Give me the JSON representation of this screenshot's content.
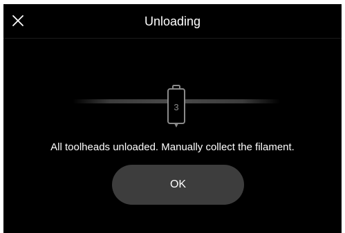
{
  "header": {
    "title": "Unloading",
    "close_icon": "close-icon"
  },
  "toolhead": {
    "number": "3",
    "icon": "toolhead-icon"
  },
  "message": "All toolheads unloaded. Manually collect the filament.",
  "actions": {
    "ok_label": "OK"
  },
  "colors": {
    "background": "#000000",
    "button": "#3d3d3d",
    "text": "#ffffff",
    "muted": "#8a8a8a"
  }
}
